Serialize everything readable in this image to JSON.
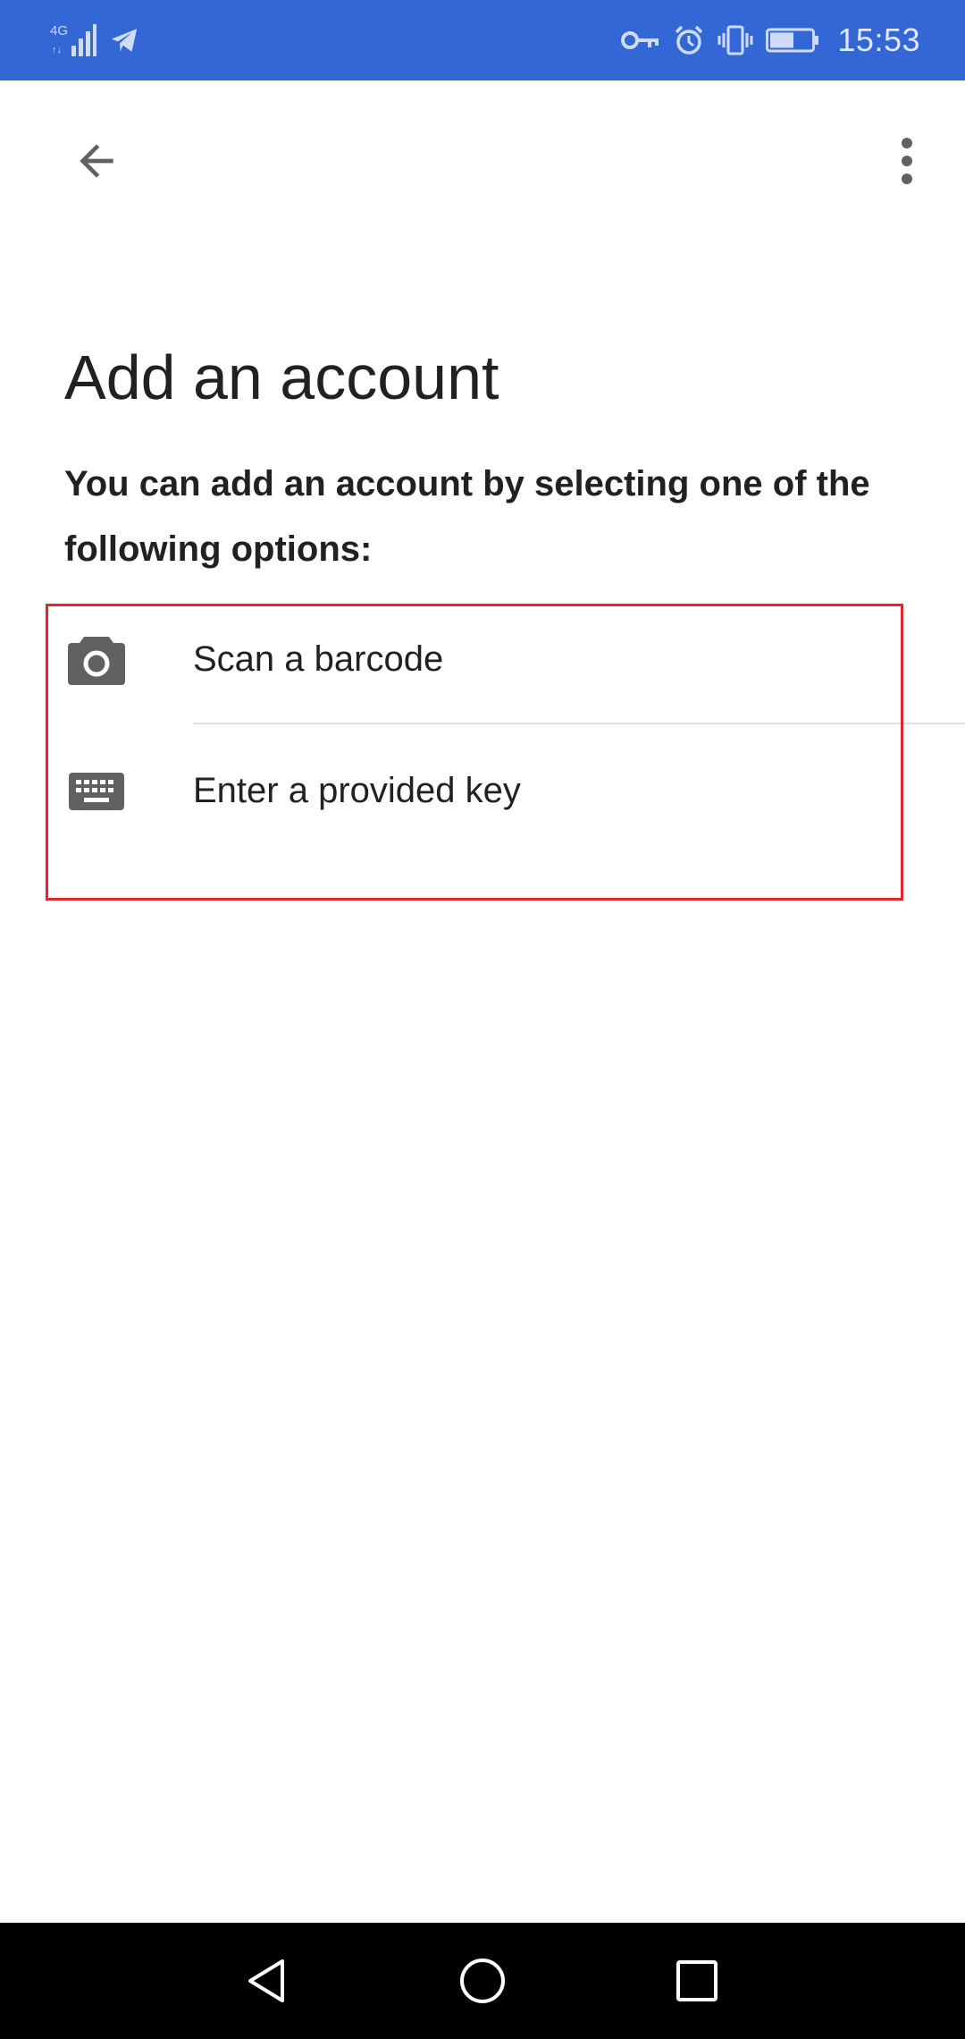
{
  "status_bar": {
    "network_label": "4G",
    "time": "15:53",
    "icons": [
      "network-4g-icon",
      "signal-icon",
      "telegram-icon",
      "vpn-key-icon",
      "alarm-icon",
      "vibrate-icon",
      "battery-icon"
    ]
  },
  "app_bar": {
    "back_icon": "arrow-back-icon",
    "overflow_icon": "more-vert-icon"
  },
  "page": {
    "title": "Add an account",
    "subtitle": "You can add an account by selecting one of the following options:"
  },
  "options": [
    {
      "label": "Scan a barcode",
      "icon": "camera-icon"
    },
    {
      "label": "Enter a provided key",
      "icon": "keyboard-icon"
    }
  ],
  "nav_bar": {
    "icons": [
      "nav-back-icon",
      "nav-home-icon",
      "nav-recents-icon"
    ]
  },
  "colors": {
    "status_bar": "#3367d6",
    "highlight_border": "#e3262b",
    "text_primary": "#212121",
    "icon_gray": "#757575"
  }
}
